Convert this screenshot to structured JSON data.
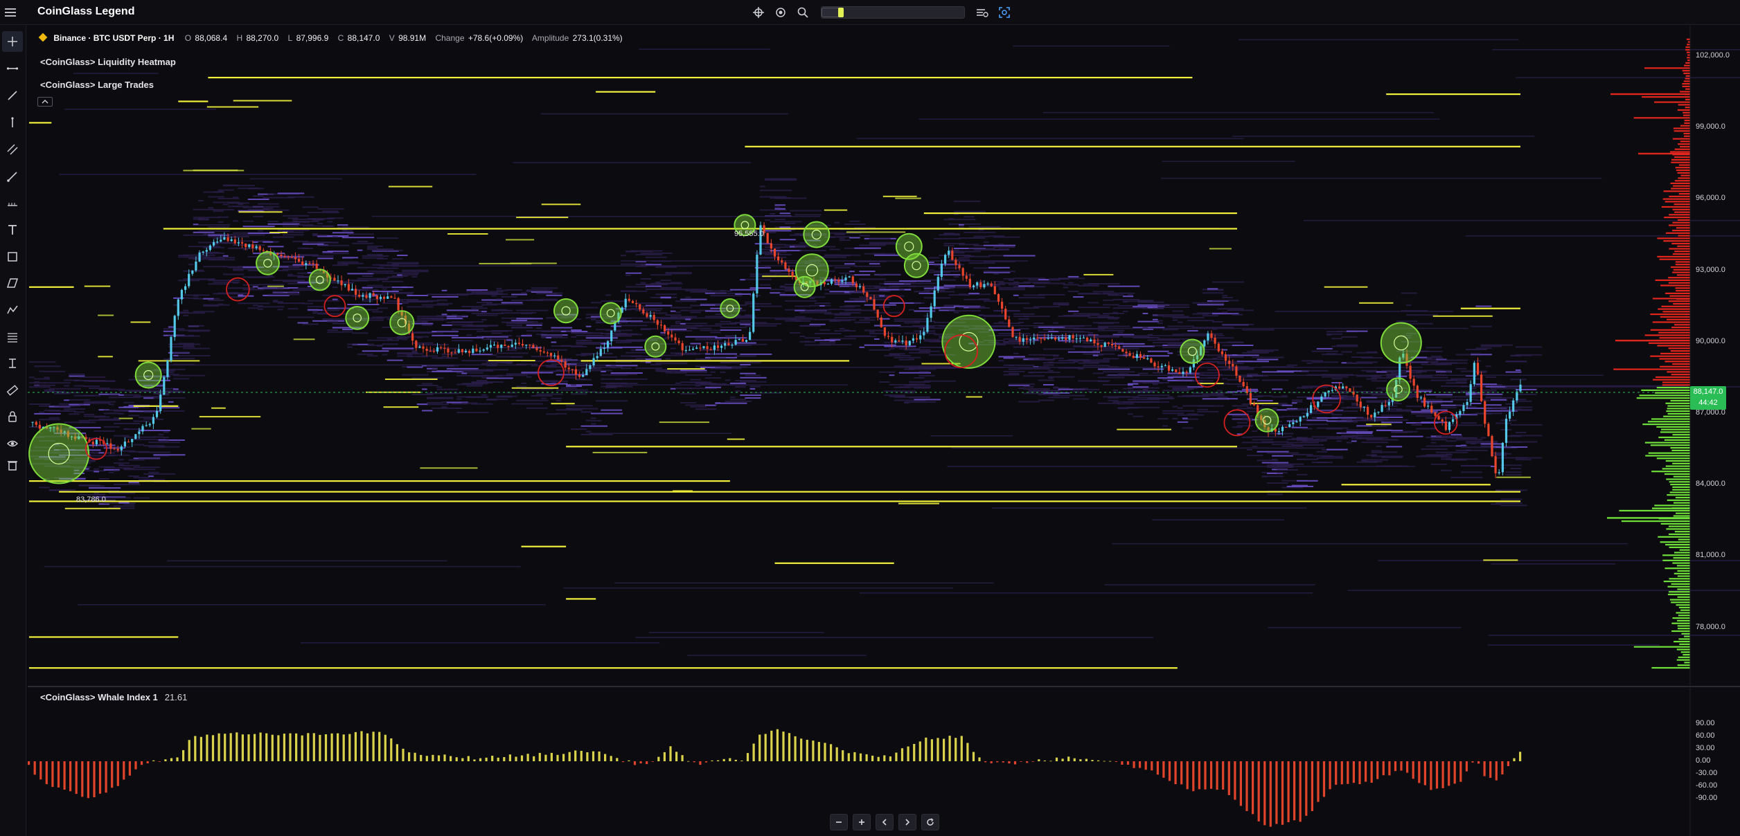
{
  "app": {
    "title": "CoinGlass Legend"
  },
  "top_tools": [
    {
      "name": "crosshair-settings-icon"
    },
    {
      "name": "camera-settings-icon"
    },
    {
      "name": "search-icon"
    },
    {
      "name": "layout-settings-icon"
    },
    {
      "name": "screenshot-icon"
    }
  ],
  "left_tools": [
    "cursor-crosshair-icon",
    "horizontal-line-icon",
    "trend-line-icon",
    "vertical-line-icon",
    "parallel-channel-icon",
    "ray-icon",
    "ruler-dots-icon",
    "text-tool-icon",
    "rectangle-icon",
    "parallelogram-icon",
    "wave-pattern-icon",
    "fibonacci-icon",
    "measure-icon",
    "ruler-icon",
    "lock-icon",
    "eye-icon",
    "trash-icon"
  ],
  "legend": {
    "symbol": "Binance · BTC USDT Perp · 1H",
    "open_label": "O",
    "open": "88,068.4",
    "high_label": "H",
    "high": "88,270.0",
    "low_label": "L",
    "low": "87,996.9",
    "close_label": "C",
    "close": "88,147.0",
    "volume_label": "V",
    "volume": "98.91M",
    "change_label": "Change",
    "change": "+78.6(+0.09%)",
    "amplitude_label": "Amplitude",
    "amplitude": "273.1(0.31%)",
    "indicator_1": "<CoinGlass> Liquidity Heatmap",
    "indicator_2": "<CoinGlass> Large Trades"
  },
  "annotations": {
    "high_label": "95,555.0",
    "low_label": "83,786.0"
  },
  "price_axis": {
    "ticks": [
      "102,000.0",
      "99,000.0",
      "96,000.0",
      "93,000.0",
      "90,000.0",
      "87,000.0",
      "84,000.0",
      "81,000.0",
      "78,000.0"
    ],
    "current_price": "88,147.0",
    "countdown": "44:42"
  },
  "whale_index": {
    "name": "<CoinGlass> Whale Index 1",
    "value": "21.61",
    "ticks": [
      "90.00",
      "60.00",
      "30.00",
      "0.00",
      "-30.00",
      "-60.00",
      "-90.00"
    ]
  },
  "bottom_nav": [
    {
      "name": "zoom-out-icon"
    },
    {
      "name": "zoom-in-icon"
    },
    {
      "name": "scroll-left-icon"
    },
    {
      "name": "scroll-right-icon"
    },
    {
      "name": "reset-chart-icon"
    }
  ],
  "colors": {
    "background": "#0c0c10",
    "heatmap_dim": "#2c1f4e",
    "heatmap_level": "#6a4fc8",
    "heatmap_bright": "#f2f23a",
    "candle_up": "#54c8e8",
    "candle_down": "#e8452c",
    "buy_bubble": "#7fdc3a",
    "sell_bubble": "#d62020",
    "whale_positive": "#d9d24a",
    "whale_negative": "#e0442a",
    "current_price": "#2bbd55"
  },
  "chart_data": [
    {
      "type": "candlestick",
      "title": "Binance · BTC USDT Perp · 1H",
      "timeframe": "1H",
      "ohlc_last": {
        "open": 88068.4,
        "high": 88270.0,
        "low": 87996.9,
        "close": 88147.0
      },
      "price_range": [
        76000,
        104000
      ],
      "y_ticks": [
        102000,
        99000,
        96000,
        93000,
        90000,
        87000,
        84000,
        81000,
        78000
      ],
      "current_price": 88147.0,
      "marked_high": 95555.0,
      "marked_low": 83786.0,
      "path_knots": [
        [
          0,
          86600
        ],
        [
          0.06,
          85500
        ],
        [
          0.085,
          86800
        ],
        [
          0.09,
          88300
        ],
        [
          0.1,
          91800
        ],
        [
          0.115,
          93800
        ],
        [
          0.13,
          94300
        ],
        [
          0.16,
          93800
        ],
        [
          0.19,
          93200
        ],
        [
          0.22,
          92000
        ],
        [
          0.245,
          91800
        ],
        [
          0.26,
          89700
        ],
        [
          0.29,
          89600
        ],
        [
          0.33,
          89900
        ],
        [
          0.35,
          89400
        ],
        [
          0.37,
          88600
        ],
        [
          0.385,
          89700
        ],
        [
          0.4,
          91800
        ],
        [
          0.42,
          90900
        ],
        [
          0.44,
          89600
        ],
        [
          0.47,
          89900
        ],
        [
          0.483,
          90200
        ],
        [
          0.49,
          95000
        ],
        [
          0.5,
          93500
        ],
        [
          0.52,
          92400
        ],
        [
          0.55,
          92700
        ],
        [
          0.565,
          91700
        ],
        [
          0.575,
          90100
        ],
        [
          0.59,
          89900
        ],
        [
          0.6,
          90500
        ],
        [
          0.615,
          93900
        ],
        [
          0.63,
          92400
        ],
        [
          0.645,
          92400
        ],
        [
          0.66,
          90100
        ],
        [
          0.7,
          90200
        ],
        [
          0.73,
          89700
        ],
        [
          0.75,
          89200
        ],
        [
          0.775,
          88600
        ],
        [
          0.79,
          90300
        ],
        [
          0.81,
          88600
        ],
        [
          0.83,
          86200
        ],
        [
          0.85,
          86600
        ],
        [
          0.87,
          87900
        ],
        [
          0.88,
          88200
        ],
        [
          0.9,
          86900
        ],
        [
          0.915,
          87700
        ],
        [
          0.92,
          89700
        ],
        [
          0.93,
          87800
        ],
        [
          0.95,
          86400
        ],
        [
          0.965,
          87500
        ],
        [
          0.97,
          89400
        ],
        [
          0.975,
          87000
        ],
        [
          0.985,
          84100
        ],
        [
          0.99,
          86700
        ],
        [
          1.0,
          88147
        ]
      ],
      "large_trades": [
        {
          "t": 0.02,
          "price": 85300,
          "side": "buy",
          "size": 5
        },
        {
          "t": 0.045,
          "price": 85500,
          "side": "sell",
          "size": 1
        },
        {
          "t": 0.08,
          "price": 88600,
          "side": "buy",
          "size": 1.5
        },
        {
          "t": 0.14,
          "price": 92200,
          "side": "sell",
          "size": 1.2
        },
        {
          "t": 0.16,
          "price": 93300,
          "side": "buy",
          "size": 1.2
        },
        {
          "t": 0.22,
          "price": 91000,
          "side": "buy",
          "size": 1.2
        },
        {
          "t": 0.195,
          "price": 92600,
          "side": "buy",
          "size": 1
        },
        {
          "t": 0.205,
          "price": 91500,
          "side": "sell",
          "size": 1
        },
        {
          "t": 0.25,
          "price": 90800,
          "side": "buy",
          "size": 1.3
        },
        {
          "t": 0.35,
          "price": 88700,
          "side": "sell",
          "size": 1.5
        },
        {
          "t": 0.36,
          "price": 91300,
          "side": "buy",
          "size": 1.3
        },
        {
          "t": 0.42,
          "price": 89800,
          "side": "buy",
          "size": 1
        },
        {
          "t": 0.39,
          "price": 91200,
          "side": "buy",
          "size": 1
        },
        {
          "t": 0.48,
          "price": 94900,
          "side": "buy",
          "size": 1
        },
        {
          "t": 0.47,
          "price": 91400,
          "side": "buy",
          "size": 0.8
        },
        {
          "t": 0.528,
          "price": 94500,
          "side": "buy",
          "size": 1.5
        },
        {
          "t": 0.525,
          "price": 93000,
          "side": "buy",
          "size": 2.2
        },
        {
          "t": 0.52,
          "price": 92300,
          "side": "buy",
          "size": 1
        },
        {
          "t": 0.58,
          "price": 91500,
          "side": "sell",
          "size": 1
        },
        {
          "t": 0.59,
          "price": 94000,
          "side": "buy",
          "size": 1.5
        },
        {
          "t": 0.595,
          "price": 93200,
          "side": "buy",
          "size": 1.3
        },
        {
          "t": 0.63,
          "price": 90000,
          "side": "buy",
          "size": 4.3
        },
        {
          "t": 0.625,
          "price": 89600,
          "side": "sell",
          "size": 2.2
        },
        {
          "t": 0.78,
          "price": 89600,
          "side": "buy",
          "size": 1.3
        },
        {
          "t": 0.79,
          "price": 88600,
          "side": "sell",
          "size": 1.3
        },
        {
          "t": 0.81,
          "price": 86600,
          "side": "sell",
          "size": 1.5
        },
        {
          "t": 0.83,
          "price": 86700,
          "side": "buy",
          "size": 1.2
        },
        {
          "t": 0.87,
          "price": 87600,
          "side": "sell",
          "size": 1.7
        },
        {
          "t": 0.92,
          "price": 89950,
          "side": "buy",
          "size": 3
        },
        {
          "t": 0.918,
          "price": 88000,
          "side": "buy",
          "size": 1.2
        },
        {
          "t": 0.95,
          "price": 86600,
          "side": "sell",
          "size": 1.2
        }
      ],
      "heatmap_bright_levels": [
        {
          "price": 101100,
          "from": 0.12,
          "to": 0.78
        },
        {
          "price": 100500,
          "from": 0.38,
          "to": 0.42
        },
        {
          "price": 100400,
          "from": 0.91,
          "to": 1.0
        },
        {
          "price": 100100,
          "from": 0.1,
          "to": 0.12
        },
        {
          "price": 99200,
          "from": 0.0,
          "to": 0.015
        },
        {
          "price": 98200,
          "from": 0.48,
          "to": 1.0
        },
        {
          "price": 97200,
          "from": 0.11,
          "to": 0.14
        },
        {
          "price": 95400,
          "from": 0.6,
          "to": 0.81
        },
        {
          "price": 94750,
          "from": 0.09,
          "to": 0.81
        },
        {
          "price": 92300,
          "from": 0.0,
          "to": 0.03
        },
        {
          "price": 91400,
          "from": 0.96,
          "to": 1.0
        },
        {
          "price": 89200,
          "from": 0.37,
          "to": 0.55
        },
        {
          "price": 87300,
          "from": 0.07,
          "to": 0.1
        },
        {
          "price": 85600,
          "from": 0.36,
          "to": 0.81
        },
        {
          "price": 84150,
          "from": 0.0,
          "to": 0.47
        },
        {
          "price": 84000,
          "from": 0.88,
          "to": 0.98
        },
        {
          "price": 83700,
          "from": 0.02,
          "to": 1.0
        },
        {
          "price": 83300,
          "from": 0.0,
          "to": 1.0
        },
        {
          "price": 81400,
          "from": 0.33,
          "to": 0.36
        },
        {
          "price": 80700,
          "from": 0.5,
          "to": 0.58
        },
        {
          "price": 79200,
          "from": 0.36,
          "to": 0.38
        },
        {
          "price": 77600,
          "from": 0.0,
          "to": 0.1
        },
        {
          "price": 76300,
          "from": 0.0,
          "to": 0.77
        }
      ]
    },
    {
      "type": "bar",
      "title": "<CoinGlass> Whale Index 1",
      "latest_value": 21.61,
      "ylim": [
        -90,
        90
      ],
      "y_ticks": [
        90,
        60,
        30,
        0,
        -30,
        -60,
        -90
      ],
      "bar_count": 252,
      "knots": [
        [
          0,
          -12
        ],
        [
          0.01,
          -55
        ],
        [
          0.04,
          -88
        ],
        [
          0.06,
          -60
        ],
        [
          0.075,
          -8
        ],
        [
          0.1,
          10
        ],
        [
          0.11,
          62
        ],
        [
          0.14,
          66
        ],
        [
          0.19,
          64
        ],
        [
          0.22,
          70
        ],
        [
          0.24,
          66
        ],
        [
          0.255,
          18
        ],
        [
          0.3,
          8
        ],
        [
          0.35,
          18
        ],
        [
          0.38,
          26
        ],
        [
          0.39,
          12
        ],
        [
          0.4,
          0
        ],
        [
          0.41,
          -8
        ],
        [
          0.42,
          2
        ],
        [
          0.43,
          34
        ],
        [
          0.44,
          6
        ],
        [
          0.45,
          -6
        ],
        [
          0.47,
          4
        ],
        [
          0.48,
          6
        ],
        [
          0.49,
          64
        ],
        [
          0.5,
          76
        ],
        [
          0.52,
          52
        ],
        [
          0.54,
          40
        ],
        [
          0.55,
          20
        ],
        [
          0.565,
          12
        ],
        [
          0.58,
          16
        ],
        [
          0.6,
          56
        ],
        [
          0.625,
          60
        ],
        [
          0.64,
          0
        ],
        [
          0.66,
          -4
        ],
        [
          0.7,
          8
        ],
        [
          0.72,
          2
        ],
        [
          0.73,
          -5
        ],
        [
          0.75,
          -20
        ],
        [
          0.78,
          -70
        ],
        [
          0.8,
          -65
        ],
        [
          0.83,
          -160
        ],
        [
          0.855,
          -140
        ],
        [
          0.875,
          -60
        ],
        [
          0.9,
          -50
        ],
        [
          0.92,
          -20
        ],
        [
          0.94,
          -70
        ],
        [
          0.96,
          -50
        ],
        [
          0.97,
          10
        ],
        [
          0.975,
          -30
        ],
        [
          0.985,
          -50
        ],
        [
          0.99,
          -25
        ],
        [
          1.0,
          24
        ]
      ]
    }
  ]
}
